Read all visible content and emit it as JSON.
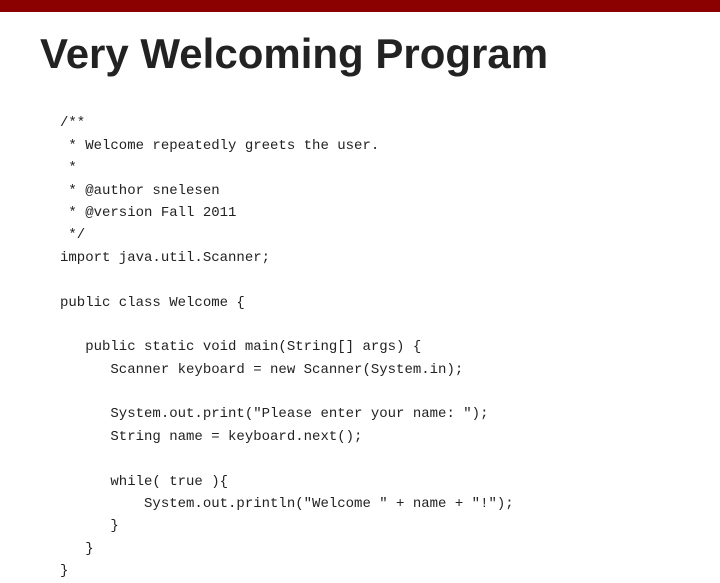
{
  "topbar": {
    "color": "#8b0000"
  },
  "title": "Very Welcoming Program",
  "code": {
    "lines": [
      "/**",
      " * Welcome repeatedly greets the user.",
      " *",
      " * @author snelesen",
      " * @version Fall 2011",
      " */",
      "import java.util.Scanner;",
      "",
      "public class Welcome {",
      "",
      "   public static void main(String[] args) {",
      "      Scanner keyboard = new Scanner(System.in);",
      "",
      "      System.out.print(\"Please enter your name: \");",
      "      String name = keyboard.next();",
      "",
      "      while( true ){",
      "          System.out.println(\"Welcome \" + name + \"!\");",
      "      }",
      "   }",
      "}"
    ]
  }
}
